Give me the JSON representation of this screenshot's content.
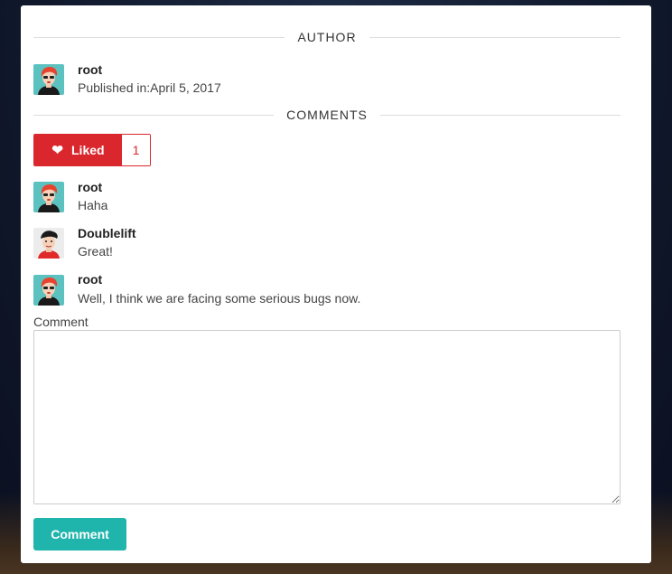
{
  "author_section": {
    "heading": "AUTHOR",
    "name": "root",
    "published_prefix": "Published in:",
    "published_date": "April 5, 2017",
    "avatar_icon": "avatar-red-hair-icon"
  },
  "comments_section": {
    "heading": "COMMENTS",
    "like": {
      "label": "Liked",
      "count": "1",
      "icon": "heart-icon",
      "color": "#d9272d"
    },
    "comments": [
      {
        "author": "root",
        "text": "Haha",
        "avatar_icon": "avatar-red-hair-icon"
      },
      {
        "author": "Doublelift",
        "text": "Great!",
        "avatar_icon": "avatar-dark-hair-icon"
      },
      {
        "author": "root",
        "text": "Well, I think we are facing some serious bugs now.",
        "avatar_icon": "avatar-red-hair-icon"
      }
    ]
  },
  "comment_form": {
    "label": "Comment",
    "textarea_value": "",
    "submit_label": "Comment",
    "accent_color": "#1fb5ac"
  }
}
